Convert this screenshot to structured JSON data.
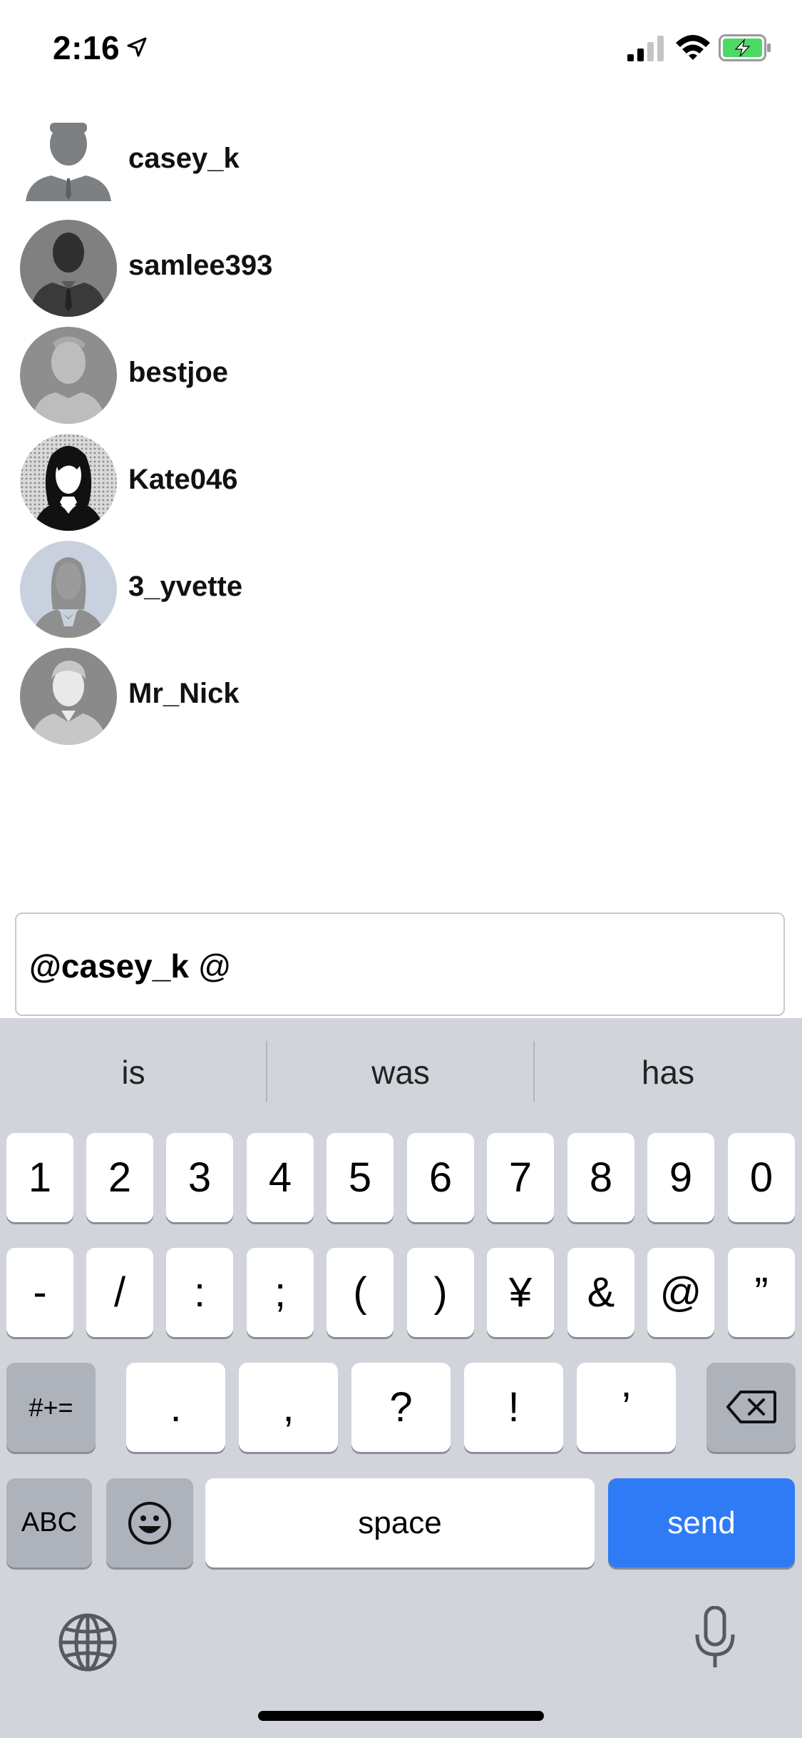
{
  "status_bar": {
    "time": "2:16"
  },
  "users": [
    {
      "name": "casey_k",
      "avatar": "male-suit-avatar"
    },
    {
      "name": "samlee393",
      "avatar": "dark-suit-avatar"
    },
    {
      "name": "bestjoe",
      "avatar": "gray-silhouette-avatar"
    },
    {
      "name": "Kate046",
      "avatar": "female-dark-hair-avatar"
    },
    {
      "name": "3_yvette",
      "avatar": "female-silhouette-avatar"
    },
    {
      "name": "Mr_Nick",
      "avatar": "male-face-avatar"
    }
  ],
  "input": {
    "mention": "@casey_k",
    "typed": " @"
  },
  "keyboard": {
    "predictions": [
      "is",
      "was",
      "has"
    ],
    "row1": [
      "1",
      "2",
      "3",
      "4",
      "5",
      "6",
      "7",
      "8",
      "9",
      "0"
    ],
    "row2": [
      "-",
      "/",
      ":",
      ";",
      "(",
      ")",
      "¥",
      "&",
      "@",
      "”"
    ],
    "row3": {
      "mode": "#+=",
      "keys": [
        ".",
        ",",
        "?",
        "!",
        "’"
      ]
    },
    "row4": {
      "abc": "ABC",
      "space": "space",
      "send": "send"
    }
  },
  "colors": {
    "send_key": "#2f7bf6",
    "keyboard_bg": "#d1d4da",
    "battery": "#4cd964"
  }
}
